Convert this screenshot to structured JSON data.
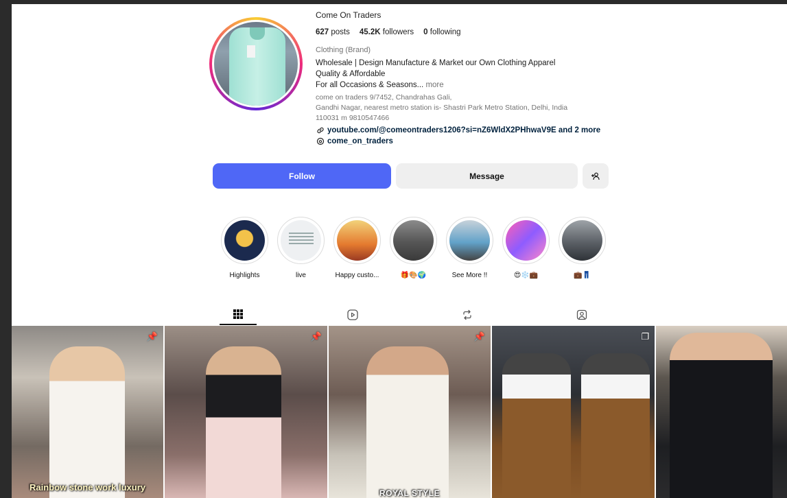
{
  "profile": {
    "username": "Come On Traders",
    "stats": {
      "posts_count": "627",
      "posts_label": "posts",
      "followers_count": "45.2K",
      "followers_label": "followers",
      "following_count": "0",
      "following_label": "following"
    },
    "category": "Clothing (Brand)",
    "bio_lines": [
      "Wholesale | Design Manufacture & Market our Own Clothing Apparel",
      "Quality & Affordable",
      "For all Occasions & Seasons..."
    ],
    "more_label": "more",
    "address_lines": [
      "come on traders 9/7452, Chandrahas Gali,",
      "Gandhi Nagar, nearest metro station is- Shastri Park Metro Station, Delhi, India",
      "110031 m 9810547466"
    ],
    "link": "youtube.com/@comeontraders1206?si=nZ6WldX2PHhwaV9E and 2 more",
    "threads_handle": "come_on_traders"
  },
  "actions": {
    "follow_label": "Follow",
    "message_label": "Message",
    "suggest_icon": "add-person-icon"
  },
  "highlights": [
    {
      "label": "Highlights"
    },
    {
      "label": "live"
    },
    {
      "label": "Happy custo..."
    },
    {
      "label": "🎁🎨🌍"
    },
    {
      "label": "See More !!"
    },
    {
      "label": "😍❄️💼"
    },
    {
      "label": "💼👖"
    }
  ],
  "tabs": [
    {
      "icon": "grid-icon",
      "active": true
    },
    {
      "icon": "reels-icon",
      "active": false
    },
    {
      "icon": "repost-icon",
      "active": false
    },
    {
      "icon": "tagged-icon",
      "active": false
    }
  ],
  "posts": [
    {
      "overlay": "Rainbow stone work luxury",
      "pinned": true
    },
    {
      "overlay": "",
      "pinned": true
    },
    {
      "overlay": "ROYAL STYLE",
      "pinned": true
    },
    {
      "overlay": "",
      "pinned": false
    },
    {
      "overlay": "",
      "pinned": false
    }
  ],
  "colors": {
    "follow_button": "#4f67f6",
    "secondary_button": "#efefef",
    "muted_text": "#737373"
  }
}
